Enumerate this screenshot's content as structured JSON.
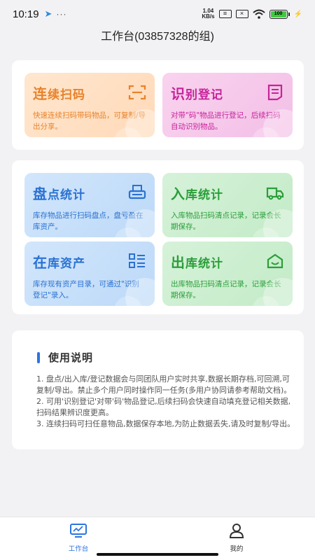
{
  "status_bar": {
    "time": "10:19",
    "dots": "···",
    "net_speed_value": "1.04",
    "net_speed_unit": "KB/s",
    "battery": "100"
  },
  "header": {
    "title": "工作台(03857328的组)"
  },
  "cards": {
    "scan": {
      "title_first": "连",
      "title_rest": "续扫码",
      "desc": "快速连续扫码带码物品，可复制/导出分享。",
      "icon": "scan-icon",
      "color": "#e8822a"
    },
    "register": {
      "title_first": "识",
      "title_rest": "别登记",
      "desc": "对带\"码\"物品进行登记，后续扫码自动识别物品。",
      "icon": "document-icon",
      "color": "#c7239b"
    },
    "inventory": {
      "title_first": "盘",
      "title_rest": "点统计",
      "desc": "库存物品进行扫码盘点，盘亏盈在库资产。",
      "icon": "printer-icon",
      "color": "#2a71d2"
    },
    "inbound": {
      "title_first": "入",
      "title_rest": "库统计",
      "desc": "入库物品扫码清点记录，记录会长期保存。",
      "icon": "truck-icon",
      "color": "#2b9e3a"
    },
    "assets": {
      "title_first": "在",
      "title_rest": "库资产",
      "desc": "库存现有资产目录，可通过\"识别登记\"录入。",
      "icon": "list-icon",
      "color": "#2a71d2"
    },
    "outbound": {
      "title_first": "出",
      "title_rest": "库统计",
      "desc": "出库物品扫码清点记录，记录会长期保存。",
      "icon": "box-icon",
      "color": "#2b9e3a"
    }
  },
  "usage": {
    "title": "使用说明",
    "lines": [
      "1. 盘点/出入库/登记数据会与同团队用户实时共享,数据长期存档,可回溯,可复制/导出。禁止多个用户同时操作同一任务(多用户协同请参考帮助文档)。",
      "2. 可用'识别登记'对带'码'物品登记,后续扫码会快速自动填充登记相关数据,扫码结果辨识度更高。",
      "3. 连续扫码可扫任意物品,数据保存本地,为防止数据丢失,请及时复制/导出。"
    ]
  },
  "tabbar": {
    "items": [
      {
        "label": "工作台",
        "icon": "monitor-icon",
        "active": true
      },
      {
        "label": "我的",
        "icon": "user-icon",
        "active": false
      }
    ],
    "active_color": "#2d74e0"
  }
}
